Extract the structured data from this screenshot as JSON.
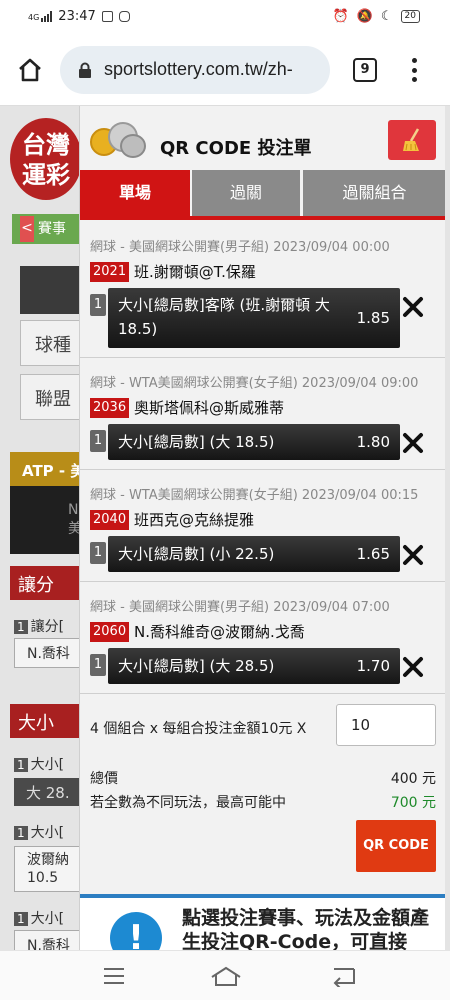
{
  "status": {
    "network": "4G",
    "time": "23:47",
    "battery": "20"
  },
  "browser": {
    "url": "sportslottery.com.tw/zh-",
    "tab_count": "9"
  },
  "background": {
    "logo": "台灣運彩",
    "tab_label": "賽事",
    "tab_arrow": "<",
    "filter_sport": "球種",
    "filter_league": "聯盟",
    "atp_label": "ATP - 美",
    "dark_label": "N",
    "dark_label2": "美",
    "section_handicap": "讓分",
    "handicap_row": "讓分[",
    "handicap_player": "N.喬科",
    "section_totals": "大小",
    "totals_row1": "大小[",
    "totals_dark": "大 28.",
    "totals_row2": "大小[",
    "totals_player": "波爾納",
    "totals_player_line": "10.5",
    "totals_row3": "大小[",
    "totals_player3": "N.喬科"
  },
  "panel": {
    "title": "QR CODE 投注單",
    "tabs": [
      {
        "label": "單場",
        "active": true
      },
      {
        "label": "過關",
        "active": false
      },
      {
        "label": "過關組合",
        "active": false
      }
    ],
    "bets": [
      {
        "league": "網球 - 美國網球公開賽(男子組) 2023/09/04 00:00",
        "code": "2021",
        "match": "班.謝爾頓@T.保羅",
        "index": "1",
        "pick_line1": "大小[總局數]客隊 (班.謝爾頓 大",
        "pick_line2": "18.5)",
        "odds": "1.85"
      },
      {
        "league": "網球 - WTA美國網球公開賽(女子組) 2023/09/04 09:00",
        "code": "2036",
        "match": "奧斯塔佩科@斯威雅蒂",
        "index": "1",
        "pick_line1": "大小[總局數] (大 18.5)",
        "odds": "1.80"
      },
      {
        "league": "網球 - WTA美國網球公開賽(女子組) 2023/09/04 00:15",
        "code": "2040",
        "match": "班西克@克絲提雅",
        "index": "1",
        "pick_line1": "大小[總局數] (小 22.5)",
        "odds": "1.65"
      },
      {
        "league": "網球 - 美國網球公開賽(男子組) 2023/09/04 07:00",
        "code": "2060",
        "match": "N.喬科維奇@波爾納.戈喬",
        "index": "1",
        "pick_line1": "大小[總局數] (大 28.5)",
        "odds": "1.70"
      }
    ],
    "summary": {
      "combo_text": "4 個組合 x 每組合投注金額10元 X",
      "amount_value": "10",
      "total_label": "總價",
      "total_value": "400 元",
      "max_label": "若全數為不同玩法，最高可能中",
      "max_value": "700 元",
      "qr_button": "QR CODE",
      "info_icon": "!",
      "info_text": "點選投注賽事、玩法及金額產生投注QR-Code，可直接"
    }
  },
  "colors": {
    "brand_red": "#d01414",
    "tab_inactive": "#8a8a8a",
    "max_win_green": "#1e8a2a",
    "qr_button": "#e03a12",
    "info_blue": "#1d8ad2"
  }
}
